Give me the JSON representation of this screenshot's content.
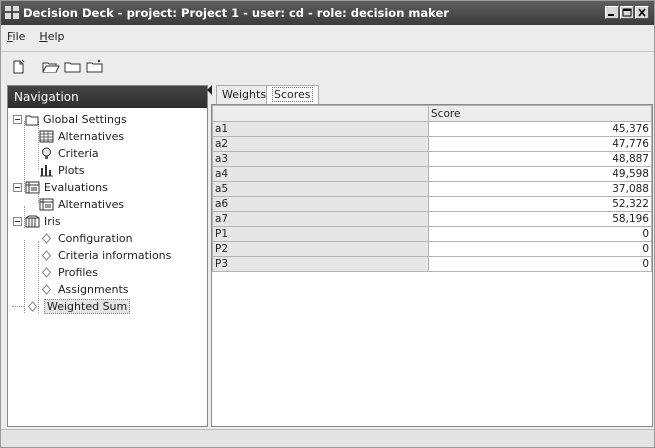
{
  "window": {
    "title": "Decision Deck - project: Project 1 - user: cd - role: decision maker"
  },
  "menu": {
    "items": [
      {
        "label": "File"
      },
      {
        "label": "Help"
      }
    ]
  },
  "toolbar": {
    "buttons": [
      "new-document-icon",
      "open-folder-icon",
      "folder-icon",
      "new-folder-icon"
    ]
  },
  "navigation": {
    "header": "Navigation",
    "tree": [
      {
        "label": "Global Settings",
        "icon": "folder-icon"
      },
      {
        "label": "Alternatives",
        "icon": "table-icon"
      },
      {
        "label": "Criteria",
        "icon": "bulb-icon"
      },
      {
        "label": "Plots",
        "icon": "bar-chart-icon"
      },
      {
        "label": "Evaluations",
        "icon": "matrix-icon"
      },
      {
        "label": "Alternatives",
        "icon": "matrix-icon"
      },
      {
        "label": "Iris",
        "icon": "module-icon"
      },
      {
        "label": "Configuration",
        "icon": "diamond-icon"
      },
      {
        "label": "Criteria informations",
        "icon": "diamond-icon"
      },
      {
        "label": "Profiles",
        "icon": "diamond-icon"
      },
      {
        "label": "Assignments",
        "icon": "diamond-icon"
      },
      {
        "label": "Weighted Sum",
        "icon": "diamond-icon",
        "selected": true
      }
    ]
  },
  "tabs": [
    {
      "label": "Weights"
    },
    {
      "label": "Scores",
      "active": true
    }
  ],
  "table": {
    "headers": [
      "",
      "Score"
    ],
    "rows": [
      {
        "name": "a1",
        "score": "45,376"
      },
      {
        "name": "a2",
        "score": "47,776"
      },
      {
        "name": "a3",
        "score": "48,887"
      },
      {
        "name": "a4",
        "score": "49,598"
      },
      {
        "name": "a5",
        "score": "37,088"
      },
      {
        "name": "a6",
        "score": "52,322"
      },
      {
        "name": "a7",
        "score": "58,196"
      },
      {
        "name": "P1",
        "score": "0"
      },
      {
        "name": "P2",
        "score": "0"
      },
      {
        "name": "P3",
        "score": "0"
      }
    ]
  }
}
